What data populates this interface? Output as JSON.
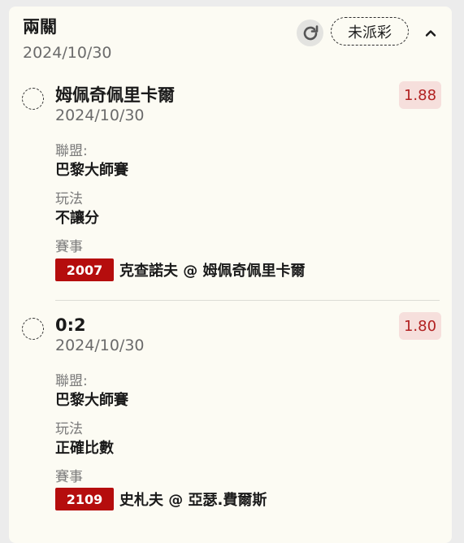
{
  "header": {
    "title": "兩關",
    "date": "2024/10/30",
    "status": "未派彩"
  },
  "legs": [
    {
      "title": "姆佩奇佩里卡爾",
      "date": "2024/10/30",
      "odds": "1.88",
      "league_label": "聯盟:",
      "league": "巴黎大師賽",
      "market_label": "玩法",
      "market": "不讓分",
      "event_label": "賽事",
      "match_id": "2007",
      "match": "克查諾夫 @ 姆佩奇佩里卡爾"
    },
    {
      "title": "0:2",
      "date": "2024/10/30",
      "odds": "1.80",
      "league_label": "聯盟:",
      "league": "巴黎大師賽",
      "market_label": "玩法",
      "market": "正確比數",
      "event_label": "賽事",
      "match_id": "2109",
      "match": "史札夫 @ 亞瑟.費爾斯"
    }
  ]
}
